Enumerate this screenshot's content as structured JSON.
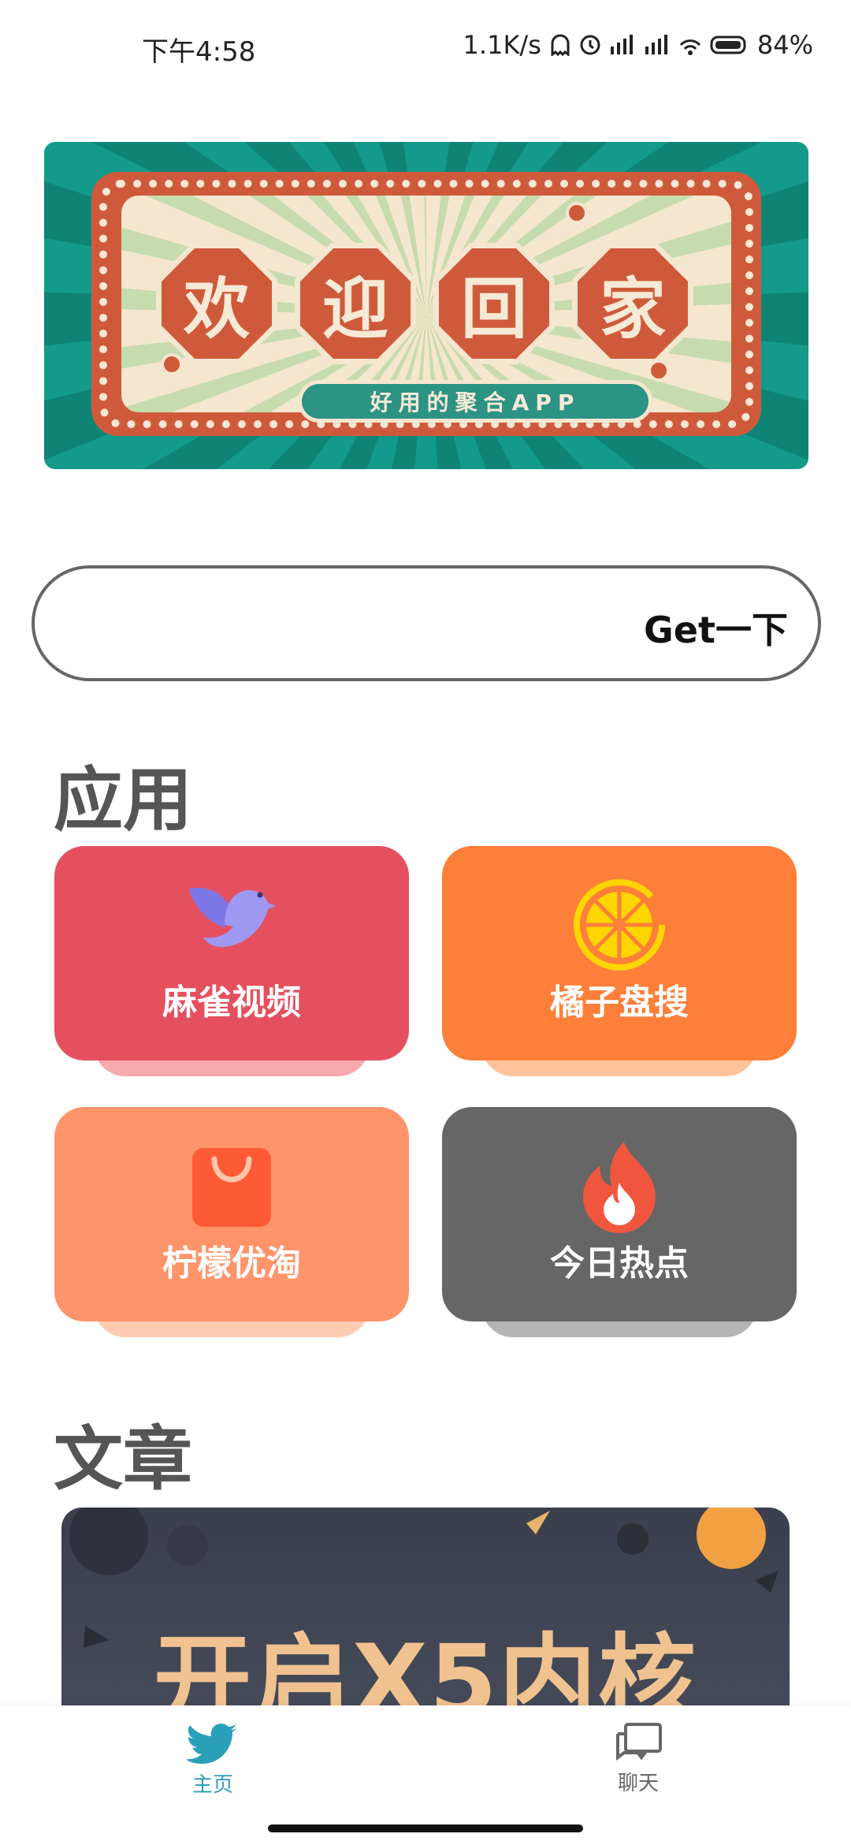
{
  "status_bar": {
    "time": "下午4:58",
    "network_speed": "1.1K/s",
    "battery": "84%"
  },
  "banner": {
    "chars": [
      "欢",
      "迎",
      "回",
      "家"
    ],
    "subtitle": "好用的聚合APP"
  },
  "search": {
    "placeholder": "",
    "button_label": "Get一下"
  },
  "apps_section": {
    "title": "应用",
    "items": [
      {
        "label": "麻雀视频",
        "icon": "bird-icon",
        "color": "#e5505f",
        "shadow": "#f6a9ad"
      },
      {
        "label": "橘子盘搜",
        "icon": "orange-slice-icon",
        "color": "#fd7f39",
        "shadow": "#ffc39a"
      },
      {
        "label": "柠檬优淘",
        "icon": "shopping-bag-icon",
        "color": "#ff946a",
        "shadow": "#ffcbb2"
      },
      {
        "label": "今日热点",
        "icon": "flame-icon",
        "color": "#666666",
        "shadow": "#b5b5b5"
      }
    ]
  },
  "articles_section": {
    "title": "文章",
    "card_title": "开启X5内核"
  },
  "bottom_nav": {
    "items": [
      {
        "label": "主页",
        "icon": "bird-icon",
        "active": true,
        "color": "#2a9fb8"
      },
      {
        "label": "聊天",
        "icon": "chat-icon",
        "active": false,
        "color": "#666666"
      }
    ]
  }
}
